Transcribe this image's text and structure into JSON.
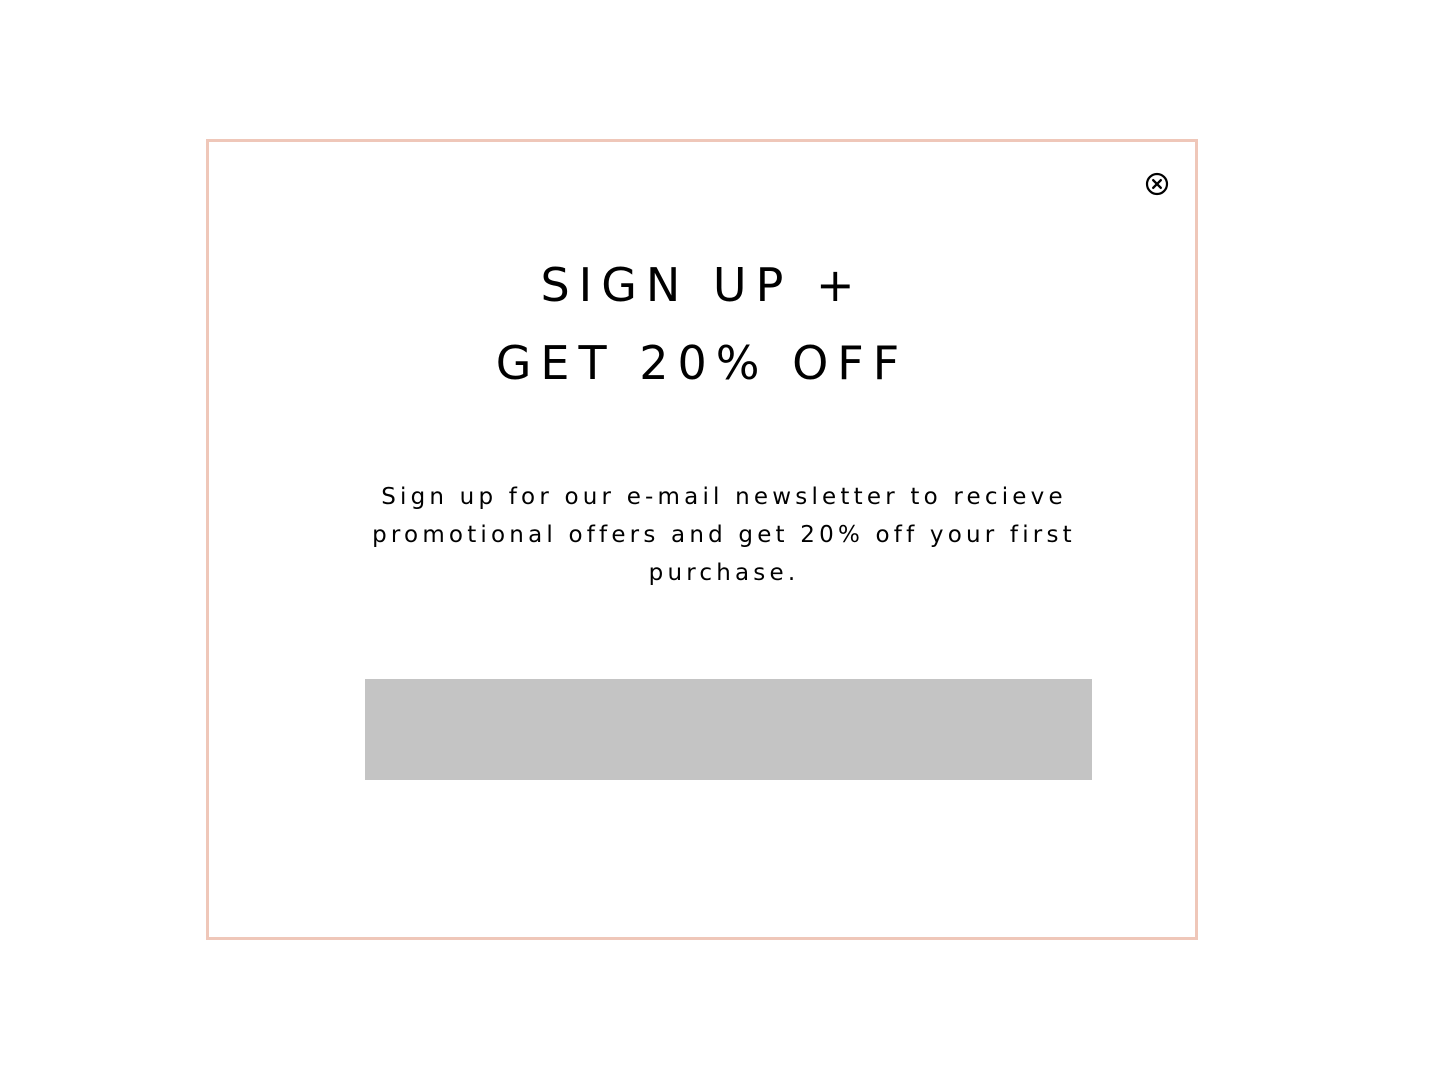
{
  "popup": {
    "headline_line1": "SIGN UP +",
    "headline_line2": "GET 20% OFF",
    "description": "Sign up for our e-mail newsletter to recieve promotional offers and get 20% off your first purchase.",
    "email_field": {
      "value": "",
      "placeholder": ""
    },
    "close_icon": "close-circle-icon"
  },
  "colors": {
    "border": "#efc7b9",
    "field": "#c4c4c4",
    "text": "#000000",
    "background": "#ffffff"
  }
}
